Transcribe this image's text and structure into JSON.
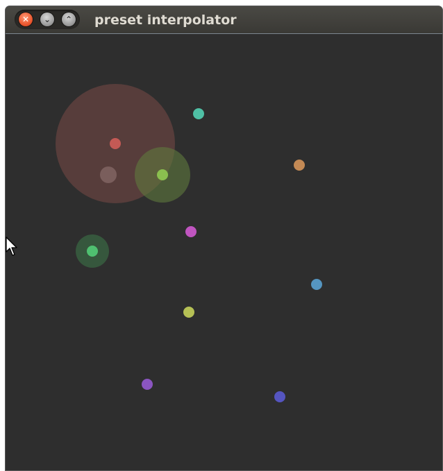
{
  "window": {
    "title": "preset interpolator",
    "buttons": {
      "close_icon": "close-icon",
      "minimize_icon": "chevron-down-icon",
      "maximize_icon": "chevron-up-icon"
    }
  },
  "canvas": {
    "background": "#2e2e2e",
    "presets": [
      {
        "id": "preset-red",
        "color": "#c45a55"
      },
      {
        "id": "preset-teal",
        "color": "#4fc0a5"
      },
      {
        "id": "preset-orange",
        "color": "#c48a55"
      },
      {
        "id": "preset-lime",
        "color": "#8abf4f"
      },
      {
        "id": "preset-magenta",
        "color": "#c055c0"
      },
      {
        "id": "preset-green",
        "color": "#4fc070"
      },
      {
        "id": "preset-blue",
        "color": "#5595c0"
      },
      {
        "id": "preset-yellow",
        "color": "#b5c055"
      },
      {
        "id": "preset-purple",
        "color": "#8a55c0"
      },
      {
        "id": "preset-indigo",
        "color": "#5555c0"
      }
    ],
    "cursor_point_color": "#7a5e5c"
  }
}
